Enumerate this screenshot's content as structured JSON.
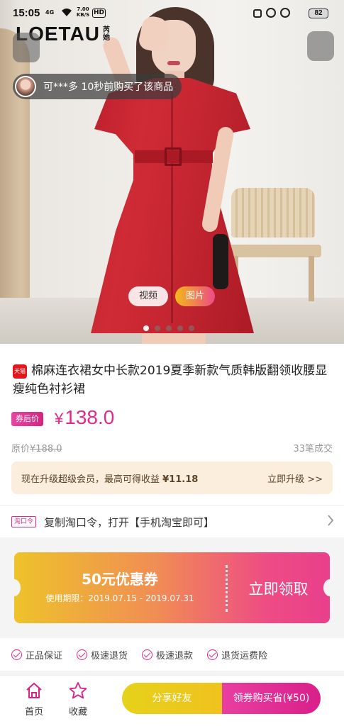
{
  "status_bar": {
    "time": "15:05",
    "network": "4G",
    "speed": "7.00 KB/S",
    "hd": "HD",
    "battery": "82"
  },
  "brand": {
    "name": "LOETAU",
    "sub": "芮她"
  },
  "ticker": {
    "text": "可***多 10秒前购买了该商品"
  },
  "media_tabs": {
    "video": "视频",
    "picture": "图片",
    "active": "picture"
  },
  "carousel": {
    "count": 5,
    "active_index": 0
  },
  "product": {
    "badge": "天猫",
    "title": "棉麻连衣裙女中长款2019夏季新款气质韩版翻领收腰显瘦纯色衬衫裙",
    "coupon_price_tag": "券后价",
    "price_symbol": "¥",
    "price": "138.0",
    "original_label": "原价",
    "original_price": "¥188.0",
    "sold": "33笔成交"
  },
  "upgrade": {
    "text": "现在升级超级会员，最高可得收益 ",
    "amount": "¥11.18",
    "link": "立即升级 >>"
  },
  "tao_code": {
    "tag": "淘口令",
    "text": "复制淘口令，打开【手机淘宝即可】"
  },
  "coupon": {
    "amount": "50元优惠券",
    "period": "使用期限：2019.07.15 - 2019.07.31",
    "claim": "立即领取"
  },
  "guarantees": [
    "正品保证",
    "极速退货",
    "极速退款",
    "退货运费险"
  ],
  "bottom_nav": {
    "home": "首页",
    "favorite": "收藏",
    "share": "分享好友",
    "buy": "领券购买省(¥50)"
  },
  "colors": {
    "accent": "#e02a8a",
    "dress": "#c52631",
    "coupon_start": "#eec32a",
    "coupon_end": "#e93f8c"
  }
}
